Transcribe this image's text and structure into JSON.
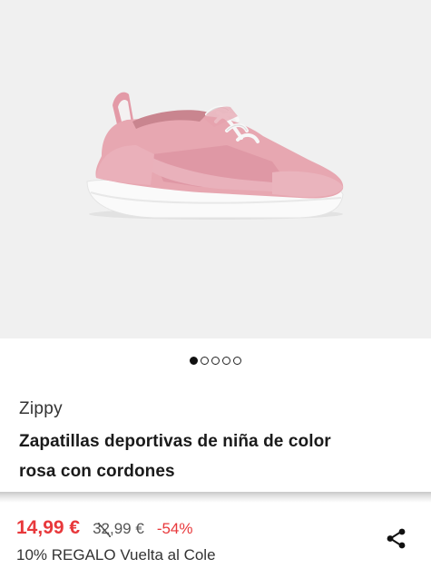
{
  "product": {
    "brand": "Zippy",
    "title_line1": "Zapatillas deportivas de niña de color",
    "title_line2": "rosa con cordones",
    "image_icon": "pink-sneaker-image"
  },
  "carousel": {
    "total": 5,
    "active": 0
  },
  "pricing": {
    "current": "14,99 €",
    "original": "32,99 €",
    "discount": "-54%",
    "promo": "10% REGALO Vuelta al Cole"
  },
  "actions": {
    "share_icon": "share-icon"
  },
  "colors": {
    "price_red": "#e8383b",
    "shoe_pink": "#e7a7b1",
    "image_bg": "#f0f0f0"
  }
}
